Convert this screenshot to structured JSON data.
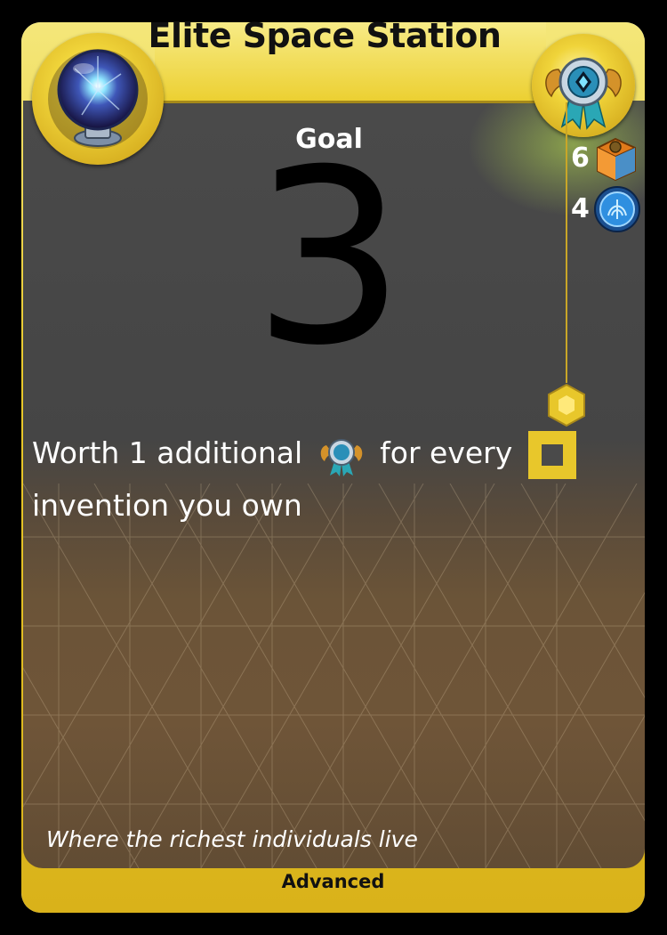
{
  "card": {
    "title": "Elite Space Station",
    "goal_label": "Goal",
    "goal_value": "3",
    "stats": [
      {
        "value": "6",
        "icon": "gear-crate-icon"
      },
      {
        "value": "4",
        "icon": "blue-tech-token-icon"
      }
    ],
    "ability": {
      "part1": "Worth 1 additional",
      "part2": "for every",
      "part3": "invention you own",
      "icons": [
        "prestige-medal-icon",
        "invention-square-icon"
      ]
    },
    "flavor": "Where the richest individuals live",
    "footer": "Advanced",
    "portrait_icon": "plasma-orb-icon",
    "badge_icon": "winged-medal-icon",
    "connector_icon": "hexagon-icon"
  },
  "colors": {
    "frame_gold": "#e9c92b",
    "panel_gray": "#454545",
    "panel_brown": "#6f5538",
    "text_light": "#ffffff",
    "text_dark": "#111111"
  }
}
